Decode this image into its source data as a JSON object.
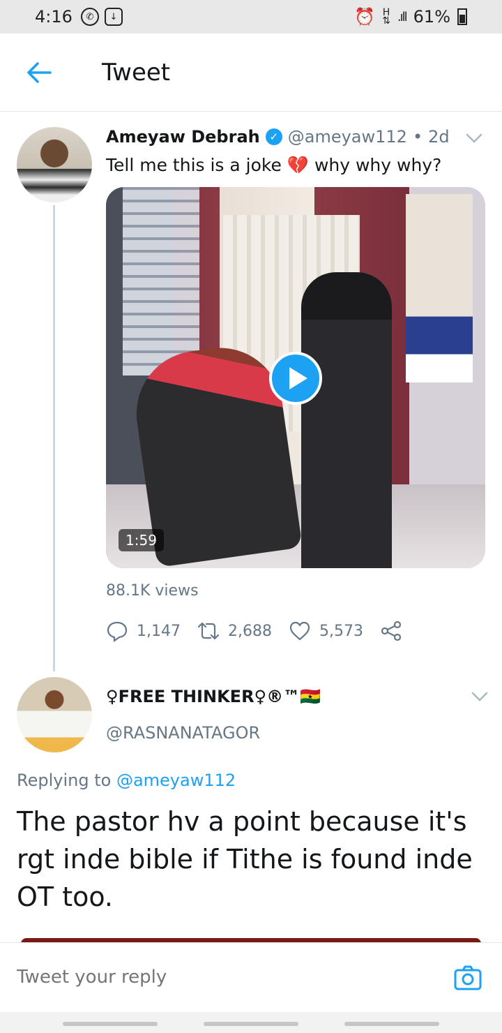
{
  "status_bar": {
    "time": "4:16",
    "signal_text": "H",
    "battery": "61%",
    "icons": [
      "whatsapp-icon",
      "download-icon",
      "alarm-icon",
      "data-icon",
      "signal-icon",
      "battery-icon"
    ]
  },
  "header": {
    "title": "Tweet",
    "back_icon": "arrow-left-icon"
  },
  "tweet": {
    "author_name": "Ameyaw Debrah",
    "verified": true,
    "handle": "@ameyaw112",
    "separator": "•",
    "age": "2d",
    "text_before_emoji": "Tell me this is a joke",
    "emoji": "💔",
    "text_after_emoji": "why why why?",
    "video_duration": "1:59",
    "views": "88.1K views",
    "replies": "1,147",
    "retweets": "2,688",
    "likes": "5,573"
  },
  "reply": {
    "author_name": "♀FREE THINKER♀®™",
    "flag": "🇬🇭",
    "handle": "@RASNANATAGOR",
    "replying_to_label": "Replying to",
    "replying_to_handle": "@ameyaw112",
    "text": "The pastor hv a point because it's rgt inde bible if Tithe is found inde OT too."
  },
  "compose": {
    "placeholder": "Tweet your reply"
  },
  "colors": {
    "accent": "#1da1f2",
    "secondary_text": "#657786",
    "divider": "#e1e8ed"
  }
}
